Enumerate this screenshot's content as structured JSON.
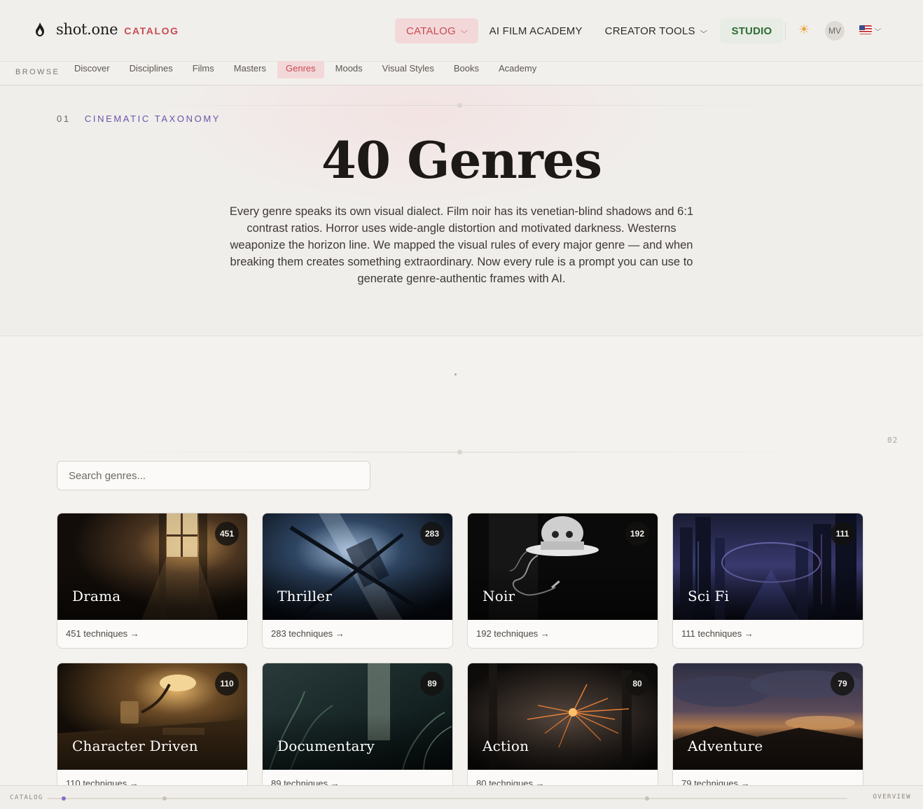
{
  "brand": {
    "name": "shot.one",
    "section": "CATALOG"
  },
  "nav": {
    "items": [
      {
        "label": "CATALOG",
        "active": true,
        "dropdown": true
      },
      {
        "label": "AI FILM ACADEMY",
        "active": false,
        "dropdown": false
      },
      {
        "label": "CREATOR TOOLS",
        "active": false,
        "dropdown": true
      },
      {
        "label": "STUDIO",
        "active": false,
        "dropdown": false
      }
    ],
    "theme_icon": "sun-icon",
    "avatar_initials": "MV",
    "locale_icon": "us-flag-icon"
  },
  "subnav": {
    "label": "BROWSE",
    "items": [
      "Discover",
      "Disciplines",
      "Films",
      "Masters",
      "Genres",
      "Moods",
      "Visual Styles",
      "Books",
      "Academy"
    ],
    "active": "Genres"
  },
  "hero": {
    "section_number": "01",
    "eyebrow": "CINEMATIC TAXONOMY",
    "title": "40 Genres",
    "description": "Every genre speaks its own visual dialect. Film noir has its venetian-blind shadows and 6:1 contrast ratios. Horror uses wide-angle distortion and motivated darkness. Westerns weaponize the horizon line. We mapped the visual rules of every major genre — and when breaking them creates something extraordinary. Now every rule is a prompt you can use to generate genre-authentic frames with AI."
  },
  "section2": {
    "section_number": "02"
  },
  "search": {
    "placeholder": "Search genres...",
    "value": ""
  },
  "genres": [
    {
      "name": "Drama",
      "count": "451",
      "meta": "451 techniques →"
    },
    {
      "name": "Thriller",
      "count": "283",
      "meta": "283 techniques →"
    },
    {
      "name": "Noir",
      "count": "192",
      "meta": "192 techniques →"
    },
    {
      "name": "Sci Fi",
      "count": "111",
      "meta": "111 techniques →"
    },
    {
      "name": "Character Driven",
      "count": "110",
      "meta": "110 techniques →"
    },
    {
      "name": "Documentary",
      "count": "89",
      "meta": "89 techniques →"
    },
    {
      "name": "Action",
      "count": "80",
      "meta": "80 techniques →"
    },
    {
      "name": "Adventure",
      "count": "79",
      "meta": "79 techniques →"
    }
  ],
  "bottombar": {
    "left": "CATALOG",
    "right": "OVERVIEW"
  },
  "colors": {
    "accent": "#c94a55",
    "eyebrow": "#6a53a8",
    "studio": "#2e6b34",
    "progress": "#8a6ad0"
  }
}
